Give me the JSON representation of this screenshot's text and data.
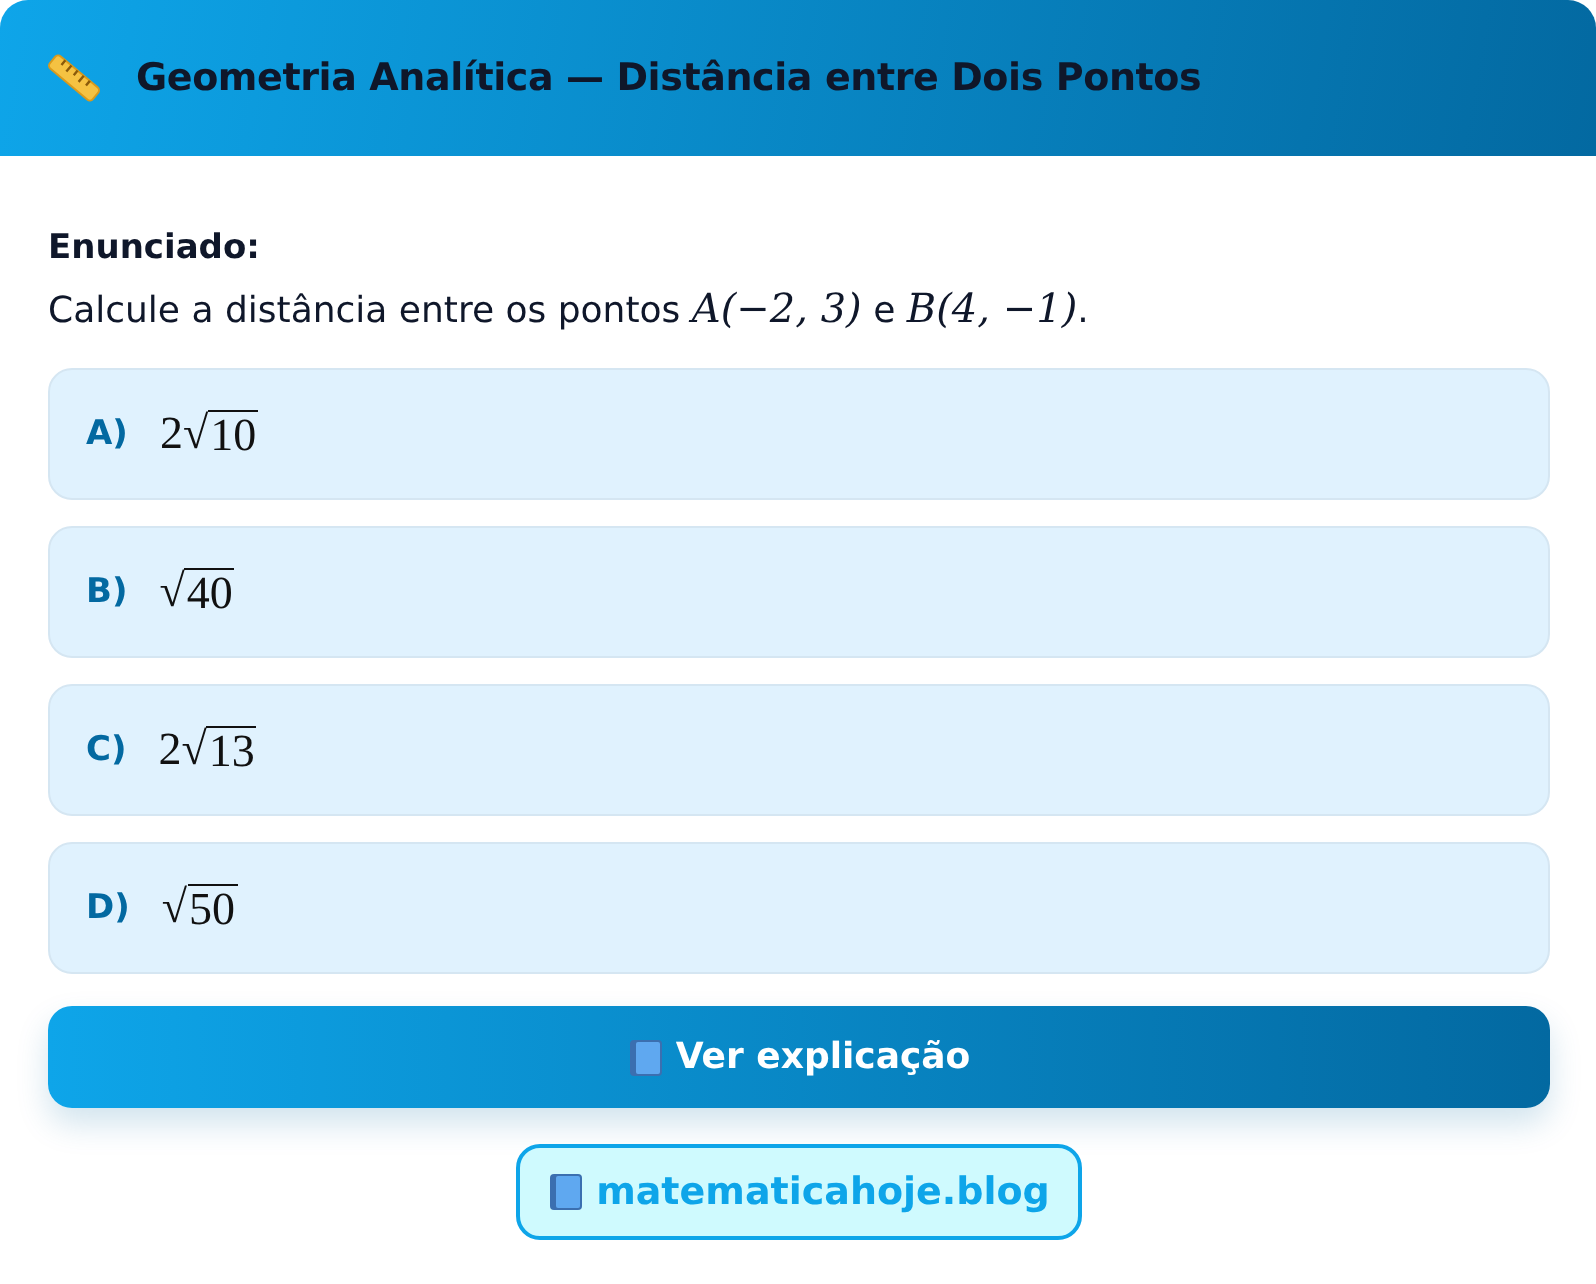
{
  "header": {
    "title": "Geometria Analítica — Distância entre Dois Pontos"
  },
  "statement": {
    "label": "Enunciado:",
    "segments": [
      {
        "kind": "text",
        "text": "Calcule a distância entre os pontos "
      },
      {
        "kind": "math",
        "text": "A(−2, 3)"
      },
      {
        "kind": "text",
        "text": " e "
      },
      {
        "kind": "math",
        "text": "B(4, −1)"
      },
      {
        "kind": "text",
        "text": "."
      }
    ]
  },
  "options": [
    {
      "letter": "A)",
      "coefficient": "2",
      "radical": "√",
      "radicand": "10"
    },
    {
      "letter": "B)",
      "radical": "√",
      "radicand": "40"
    },
    {
      "letter": "C)",
      "coefficient": "2",
      "radical": "√",
      "radicand": "13"
    },
    {
      "letter": "D)",
      "radical": "√",
      "radicand": "50"
    }
  ],
  "explain_button": {
    "label": "Ver explicação"
  },
  "site_link": {
    "label": "matematicahoje.blog"
  }
}
